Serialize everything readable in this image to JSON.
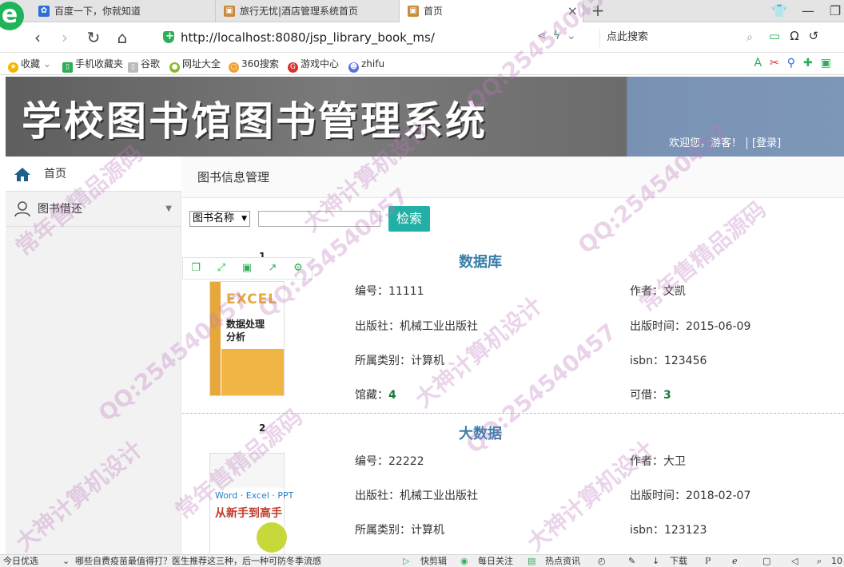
{
  "browser": {
    "tabs": [
      {
        "label": "百度一下，你就知道"
      },
      {
        "label": "旅行无忧|酒店管理系统首页"
      },
      {
        "label": "首页"
      }
    ],
    "url": "http://localhost:8080/jsp_library_book_ms/",
    "search_placeholder": "点此搜索",
    "bookmarks": [
      {
        "label": "收藏"
      },
      {
        "label": "手机收藏夹"
      },
      {
        "label": "谷歌"
      },
      {
        "label": "网址大全"
      },
      {
        "label": "360搜索"
      },
      {
        "label": "游戏中心"
      },
      {
        "label": "zhifu"
      }
    ],
    "status": {
      "left": "今日优选",
      "news": "哪些自费疫苗最值得打？医生推荐这三种，后一种可防冬季流感",
      "items": [
        "快剪辑",
        "每日关注",
        "热点资讯",
        "下载"
      ],
      "zoom": "10"
    }
  },
  "header": {
    "title": "学校图书馆图书管理系统",
    "welcome": "欢迎您，游客！",
    "login": "[登录]"
  },
  "sidebar": {
    "items": [
      {
        "label": "首页"
      },
      {
        "label": "图书借还"
      }
    ]
  },
  "main": {
    "breadcrumb": "图书信息管理",
    "filter": {
      "selected": "图书名称"
    },
    "search_button": "检索",
    "labels": {
      "id": "编号：",
      "author": "作者：",
      "publisher": "出版社：",
      "pubdate": "出版时间：",
      "category": "所属类别：",
      "isbn": "isbn：",
      "stock": "馆藏：",
      "available": "可借："
    },
    "books": [
      {
        "num": "1",
        "title": "数据库",
        "id": "11111",
        "author": "文凯",
        "publisher": "机械工业出版社",
        "pubdate": "2015-06-09",
        "category": "计算机",
        "isbn": "123456",
        "stock": "4",
        "available": "3",
        "cover": {
          "excel": "EXCEL",
          "line1": "数据处理",
          "line2": "分析"
        }
      },
      {
        "num": "2",
        "title": "大数据",
        "id": "22222",
        "author": "大卫",
        "publisher": "机械工业出版社",
        "pubdate": "2018-02-07",
        "category": "计算机",
        "isbn": "123123",
        "cover": {
          "line1": "Word · Excel · PPT",
          "line2": "从新手到高手"
        }
      }
    ]
  },
  "watermarks": [
    "QQ:254540457",
    "常年售精品源码",
    "大神计算机设计"
  ],
  "colors": {
    "accent": "#22b0a6",
    "title_blue": "#3a7fa8",
    "count_green": "#1b7a3a"
  }
}
